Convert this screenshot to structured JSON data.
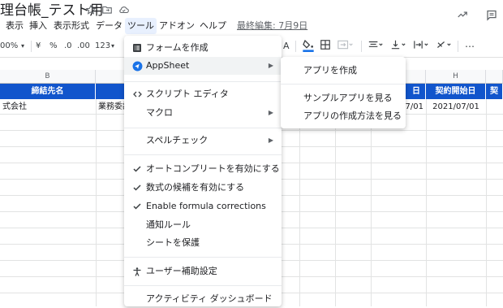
{
  "title": "理台帳_テスト用",
  "menubar": {
    "items": [
      "表示",
      "挿入",
      "表示形式",
      "データ",
      "ツール",
      "アドオン",
      "ヘルプ"
    ],
    "last_edit": "最終編集: 7月9日"
  },
  "toolbar": {
    "zoom": "00%",
    "currency": "¥",
    "percent": "%",
    "dec_decrease": ".0",
    "dec_increase": ".00",
    "format_more": "123",
    "text_color": "A",
    "more": "⋯"
  },
  "columns": {
    "b_label": "B",
    "h_label": "H",
    "header_b": "締結先名",
    "header_g_partial": "日",
    "header_h": "契約開始日",
    "header_i_partial": "契"
  },
  "row1": {
    "b": "式会社",
    "c": "業務委託",
    "g": "07/01",
    "h": "2021/07/01"
  },
  "tools_menu": {
    "items": [
      {
        "label": "フォームを作成",
        "icon": "form-icon"
      },
      {
        "label": "AppSheet",
        "icon": "appsheet-icon",
        "submenu": true
      },
      {
        "label": "スクリプト エディタ",
        "icon": "code-icon"
      },
      {
        "label": "マクロ",
        "icon": "",
        "submenu": true
      },
      {
        "label": "スペルチェック",
        "icon": "",
        "submenu": true
      },
      {
        "label": "オートコンプリートを有効にする",
        "icon": "check-icon"
      },
      {
        "label": "数式の候補を有効にする",
        "icon": "check-icon"
      },
      {
        "label": "Enable formula corrections",
        "icon": "check-icon"
      },
      {
        "label": "通知ルール",
        "icon": ""
      },
      {
        "label": "シートを保護",
        "icon": ""
      },
      {
        "label": "ユーザー補助設定",
        "icon": "accessibility-icon"
      },
      {
        "label": "アクティビティ ダッシュボード",
        "icon": ""
      }
    ]
  },
  "appsheet_submenu": {
    "items": [
      "アプリを作成",
      "サンプルアプリを見る",
      "アプリの作成方法を見る"
    ]
  },
  "colors": {
    "header_blue": "#1155cc",
    "menu_highlight": "#f1f3f4",
    "active_menu": "#e8f0fe"
  }
}
